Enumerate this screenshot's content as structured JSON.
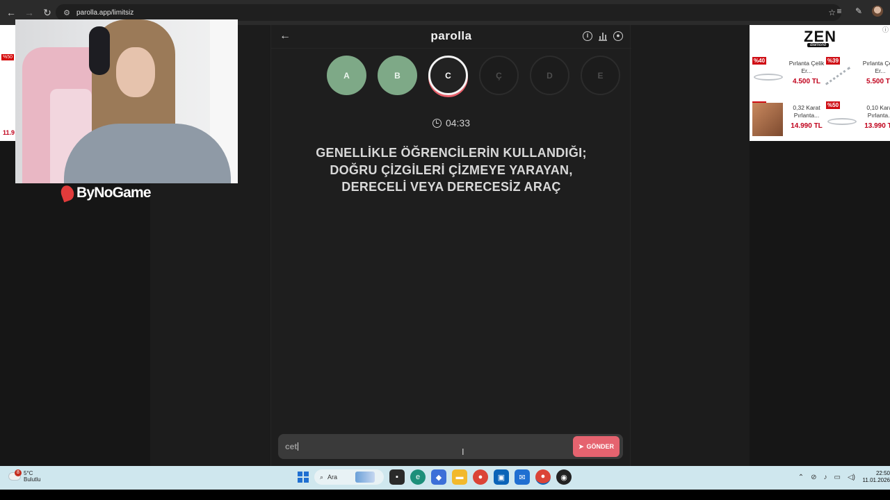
{
  "browser": {
    "url": "parolla.app/limitsiz"
  },
  "app": {
    "title": "parolla",
    "letters": [
      {
        "label": "A",
        "state": "done"
      },
      {
        "label": "B",
        "state": "done"
      },
      {
        "label": "C",
        "state": "active"
      },
      {
        "label": "Ç",
        "state": "pending"
      },
      {
        "label": "D",
        "state": "pending"
      },
      {
        "label": "E",
        "state": "pending"
      }
    ],
    "timer": "04:33",
    "question": "GENELLİKLE ÖĞRENCİLERİN KULLANDIĞI; DOĞRU ÇİZGİLERİ ÇİZMEYE YARAYAN, DERECELİ VEYA DERECESİZ ARAÇ",
    "answer_value": "cet",
    "send_label": "GÖNDER"
  },
  "overlay": {
    "brand": "ByNoGame"
  },
  "left_ad": {
    "badge": "%50",
    "price": "11.9"
  },
  "right_ad": {
    "logo": "ZEN",
    "logo_sub": "diamond",
    "products": [
      {
        "badge": "%40",
        "name": "Pırlanta Çelik Er...",
        "price": "4.500 TL",
        "img": "ring"
      },
      {
        "badge": "%39",
        "name": "Pırlanta Çelik Er...",
        "price": "5.500 TL",
        "img": "chain"
      },
      {
        "badge": "%50",
        "name": "0,32 Karat Pırlanta...",
        "price": "14.990 TL",
        "img": "photo"
      },
      {
        "badge": "%50",
        "name": "0,10 Karat Pırlanta...",
        "price": "13.990 TL",
        "img": "ring"
      }
    ]
  },
  "taskbar": {
    "weather_badge": "8",
    "temperature": "5°C",
    "weather_desc": "Bulutlu",
    "search_placeholder": "Ara",
    "time": "22:50",
    "date": "11.01.2026"
  },
  "colors": {
    "done": "#7ea987",
    "accent": "#e5636f"
  }
}
